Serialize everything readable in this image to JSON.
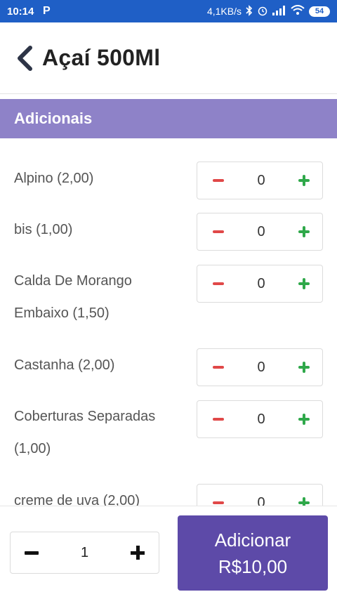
{
  "statusbar": {
    "time": "10:14",
    "app_icon": "P",
    "speed": "4,1KB/s",
    "battery": "54"
  },
  "header": {
    "title": "Açaí 500Ml"
  },
  "section": {
    "title": "Adicionais"
  },
  "items": [
    {
      "line1": "Alpino (2,00)",
      "line2": "",
      "qty": "0"
    },
    {
      "line1": "bis (1,00)",
      "line2": "",
      "qty": "0"
    },
    {
      "line1": "Calda De Morango",
      "line2": "Embaixo (1,50)",
      "qty": "0"
    },
    {
      "line1": "Castanha (2,00)",
      "line2": "",
      "qty": "0"
    },
    {
      "line1": "Coberturas Separadas",
      "line2": "(1,00)",
      "qty": "0"
    },
    {
      "line1": "creme de uva (2,00)",
      "line2": "",
      "qty": "0"
    }
  ],
  "bottom": {
    "quantity": "1",
    "add_label": "Adicionar",
    "price": "R$10,00"
  },
  "colors": {
    "status_bar": "#1f5fc6",
    "section_header": "#8e82c8",
    "add_button": "#5d4aa8",
    "minus": "#e04848",
    "plus": "#2fa84a"
  }
}
